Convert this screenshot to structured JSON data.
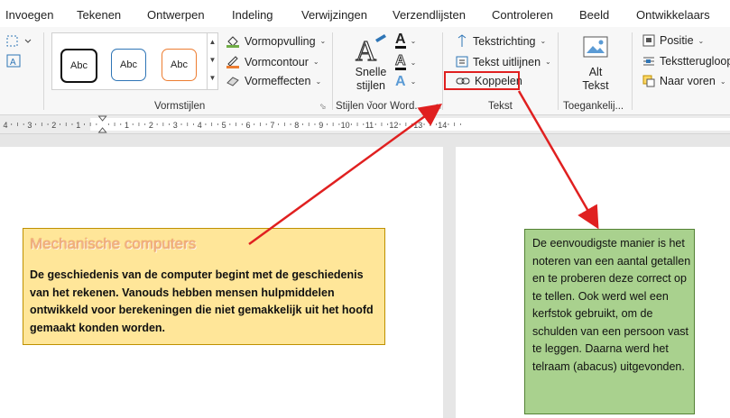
{
  "tabs": [
    "Invoegen",
    "Tekenen",
    "Ontwerpen",
    "Indeling",
    "Verwijzingen",
    "Verzendlijsten",
    "Controleren",
    "Beeld",
    "Ontwikkelaars"
  ],
  "ribbon": {
    "shape_styles": {
      "swatch_label": "Abc",
      "fill": "Vormopvulling",
      "outline": "Vormcontour",
      "effects": "Vormeffecten",
      "group": "Vormstijlen"
    },
    "wordart": {
      "quick_styles_line1": "Snelle",
      "quick_styles_line2": "stijlen",
      "letter": "A",
      "group": "Stijlen voor Word..."
    },
    "text": {
      "direction": "Tekstrichting",
      "align": "Tekst uitlijnen",
      "link": "Koppelen",
      "group": "Tekst"
    },
    "accessibility": {
      "alt_line1": "Alt",
      "alt_line2": "Tekst",
      "group": "Toegankelij..."
    },
    "arrange": {
      "position": "Positie",
      "wrap": "Tekstterugloop",
      "forward": "Naar voren"
    }
  },
  "ruler": {
    "labels": [
      "4",
      "3",
      "2",
      "1",
      "1",
      "2",
      "3",
      "4",
      "5",
      "6",
      "7",
      "8",
      "9",
      "10",
      "11",
      "12",
      "13",
      "14"
    ]
  },
  "doc": {
    "box1_title": "Mechanische computers",
    "box1_text": "De geschiedenis van de computer begint met de geschiedenis van het rekenen. Vanouds hebben mensen hulpmiddelen ontwikkeld voor berekeningen die niet gemakkelijk uit het hoofd gemaakt konden worden.",
    "box2_text": "De eenvoudigste manier is het noteren van een aantal getallen en te proberen deze correct op te tellen. Ook werd wel een kerfstok gebruikt, om de schulden van een persoon vast te leggen. Daarna werd het telraam (abacus) uitgevonden."
  },
  "colors": {
    "annotation": "#e02020",
    "box1_fill": "#ffe699",
    "box2_fill": "#a9d18e",
    "title_orange": "#f4b183"
  }
}
